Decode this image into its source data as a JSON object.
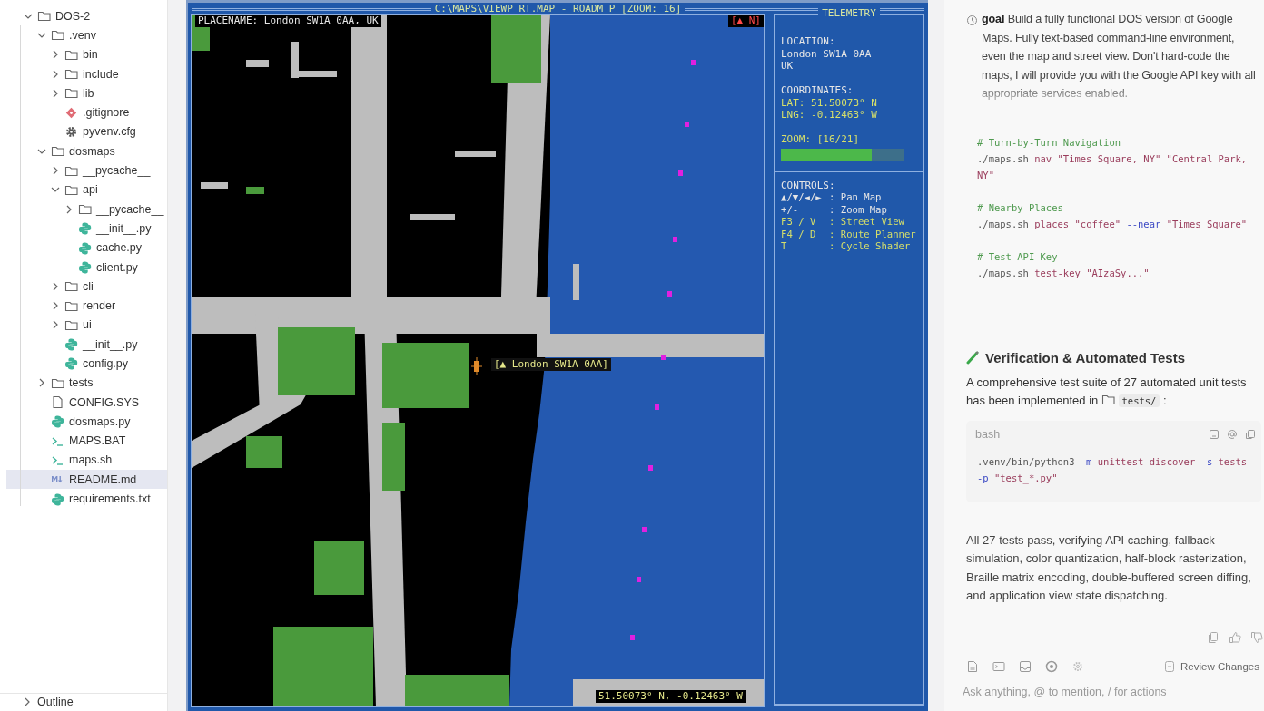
{
  "sidebar": {
    "tree": [
      {
        "label": "DOS-2",
        "kind": "folder",
        "expanded": true,
        "selected": false,
        "children": [
          {
            "label": ".venv",
            "kind": "folder",
            "expanded": true,
            "selected": false,
            "children": [
              {
                "label": "bin",
                "kind": "folder",
                "expanded": false,
                "selected": false
              },
              {
                "label": "include",
                "kind": "folder",
                "expanded": false,
                "selected": false
              },
              {
                "label": "lib",
                "kind": "folder",
                "expanded": false,
                "selected": false
              },
              {
                "label": ".gitignore",
                "kind": "git",
                "selected": false
              },
              {
                "label": "pyvenv.cfg",
                "kind": "gear",
                "selected": false
              }
            ]
          },
          {
            "label": "dosmaps",
            "kind": "folder",
            "expanded": true,
            "selected": false,
            "children": [
              {
                "label": "__pycache__",
                "kind": "folder",
                "expanded": false,
                "selected": false
              },
              {
                "label": "api",
                "kind": "folder",
                "expanded": true,
                "selected": false,
                "children": [
                  {
                    "label": "__pycache__",
                    "kind": "folder",
                    "expanded": false,
                    "selected": false
                  },
                  {
                    "label": "__init__.py",
                    "kind": "python",
                    "selected": false
                  },
                  {
                    "label": "cache.py",
                    "kind": "python",
                    "selected": false
                  },
                  {
                    "label": "client.py",
                    "kind": "python",
                    "selected": false
                  }
                ]
              },
              {
                "label": "cli",
                "kind": "folder",
                "expanded": false,
                "selected": false
              },
              {
                "label": "render",
                "kind": "folder",
                "expanded": false,
                "selected": false
              },
              {
                "label": "ui",
                "kind": "folder",
                "expanded": false,
                "selected": false
              },
              {
                "label": "__init__.py",
                "kind": "python",
                "selected": false
              },
              {
                "label": "config.py",
                "kind": "python",
                "selected": false
              }
            ]
          },
          {
            "label": "tests",
            "kind": "folder",
            "expanded": false,
            "selected": false
          },
          {
            "label": "CONFIG.SYS",
            "kind": "file",
            "selected": false
          },
          {
            "label": "dosmaps.py",
            "kind": "python",
            "selected": false
          },
          {
            "label": "MAPS.BAT",
            "kind": "terminal",
            "selected": false
          },
          {
            "label": "maps.sh",
            "kind": "terminal",
            "selected": false
          },
          {
            "label": "README.md",
            "kind": "markdown",
            "selected": true
          },
          {
            "label": "requirements.txt",
            "kind": "python",
            "selected": false
          }
        ]
      }
    ],
    "outline": {
      "label": "Outline",
      "expanded": false
    }
  },
  "dos_window": {
    "title": "C:\\MAPS\\VIEWP RT.MAP - ROADM P [ZOOM: 16]",
    "map": {
      "placename": "PLACENAME: London SW1A 0AA, UK",
      "compass": "[▲ N]",
      "marker_label": "[▲ London SW1A 0AA]",
      "coordinates": "51.50073° N, -0.12463° W"
    },
    "telemetry": {
      "title": "TELEMETRY",
      "location_heading": "LOCATION:",
      "location_lines": [
        "London SW1A 0AA",
        "UK"
      ],
      "coordinates_heading": "COORDINATES:",
      "lat": "LAT: 51.50073° N",
      "lng": "LNG: -0.12463° W",
      "zoom": {
        "label": "ZOOM: [16/21]",
        "level": 0.74
      },
      "controls_heading": "CONTROLS:",
      "controls": [
        {
          "key": "▲/▼/◄/►",
          "action": ": Pan Map",
          "color": "#e6e6e6"
        },
        {
          "key": "+/-",
          "action": ": Zoom Map",
          "color": "#e6e6e6"
        },
        {
          "key": "F3 / V",
          "action": ": Street View",
          "color": "#d6df6a"
        },
        {
          "key": "F4 / D",
          "action": ": Route Planner",
          "color": "#d6df6a"
        },
        {
          "key": "T",
          "action": ": Cycle Shader",
          "color": "#d6df6a"
        }
      ]
    }
  },
  "chat": {
    "goal": "**goal** Build a fully functional DOS version of Google Maps. Fully text-based command-line environment, even the map and street view. Don't hard-code the maps, I will provide you with the Google API key with all appropriate services enabled.",
    "snippets": [
      {
        "comment": "# Turn-by-Turn Navigation",
        "command": [
          {
            "kind": "plain",
            "text": "./maps.sh"
          },
          {
            "kind": "arg",
            "text": " nav "
          },
          {
            "kind": "string",
            "text": "\"Times Square, NY\" \"Central Park, NY\""
          }
        ]
      },
      {
        "comment": "# Nearby Places",
        "command": [
          {
            "kind": "plain",
            "text": "./maps.sh"
          },
          {
            "kind": "arg",
            "text": " places "
          },
          {
            "kind": "string",
            "text": "\"coffee\" "
          },
          {
            "kind": "flag",
            "text": "--near"
          },
          {
            "kind": "string",
            "text": " \"Times Square\""
          }
        ]
      },
      {
        "comment": "# Test API Key",
        "command": [
          {
            "kind": "plain",
            "text": "./maps.sh"
          },
          {
            "kind": "arg",
            "text": " test-key "
          },
          {
            "kind": "string",
            "text": "\"AIzaSy...\""
          }
        ]
      }
    ],
    "heading": "Verification & Automated Tests",
    "intro": {
      "text": "A comprehensive test suite of 27 automated unit tests has been implemented in",
      "code": "tests/",
      "suffix": ":"
    },
    "code_block": {
      "language": "bash",
      "command": [
        {
          "kind": "plain",
          "text": ".venv/bin/python3 "
        },
        {
          "kind": "flag",
          "text": "-m"
        },
        {
          "kind": "arg",
          "text": " unittest discover "
        },
        {
          "kind": "flag",
          "text": "-s"
        },
        {
          "kind": "arg",
          "text": " tests "
        },
        {
          "kind": "flag",
          "text": "-p"
        },
        {
          "kind": "string",
          "text": " \"test_*.py\""
        }
      ]
    },
    "summary": "All 27 tests pass, verifying API caching, fallback simulation, color quantization, half-block rasterization, Braille matrix encoding, double-buffered screen diffing, and application view state dispatching.",
    "review_button": "Review Changes",
    "input": {
      "placeholder": "Ask anything, @ to mention, / for actions"
    }
  }
}
